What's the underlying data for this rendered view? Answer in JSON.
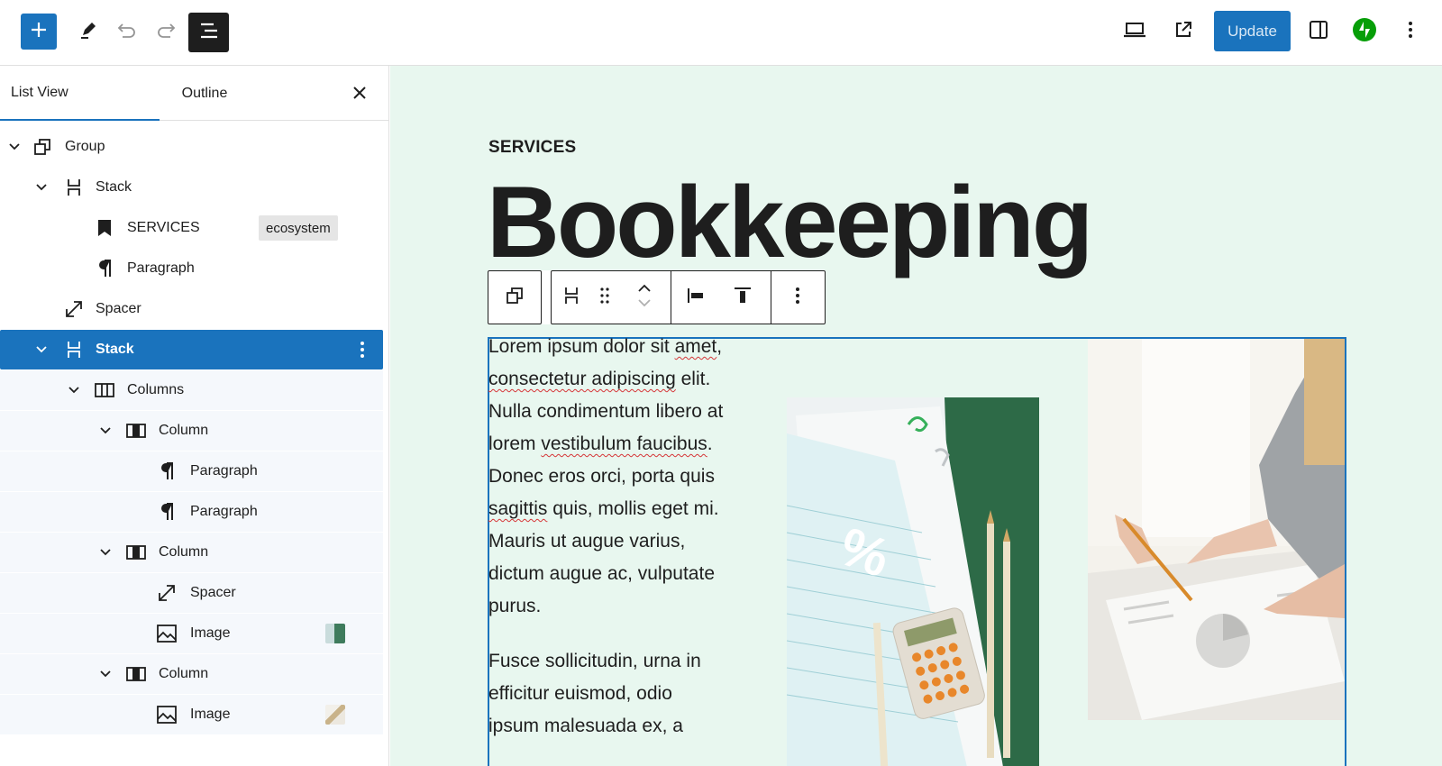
{
  "toolbar": {
    "add_label": "Toggle block inserter",
    "update_label": "Update",
    "colors": {
      "accent": "#1a73bd",
      "jetpack": "#069e08"
    },
    "icons": [
      "plus-icon",
      "pencil-icon",
      "undo-icon",
      "redo-icon",
      "list-view-icon",
      "laptop-icon",
      "external-link-icon",
      "sidebar-icon",
      "jetpack-icon",
      "more-vertical-icon"
    ]
  },
  "sidebar": {
    "tabs": [
      {
        "label": "List View",
        "active": true
      },
      {
        "label": "Outline",
        "active": false
      }
    ],
    "tree": [
      {
        "label": "Group",
        "icon": "group-icon",
        "level": 0,
        "expanded": true
      },
      {
        "label": "Stack",
        "icon": "stack-icon",
        "level": 1,
        "expanded": true
      },
      {
        "label": "SERVICES",
        "icon": "bookmark-icon",
        "level": 2,
        "badge": "ecosystem"
      },
      {
        "label": "Paragraph",
        "icon": "paragraph-icon",
        "level": 2
      },
      {
        "label": "Spacer",
        "icon": "spacer-icon",
        "level": 1
      },
      {
        "label": "Stack",
        "icon": "stack-icon",
        "level": 1,
        "expanded": true,
        "selected": true
      },
      {
        "label": "Columns",
        "icon": "columns-icon",
        "level": 2,
        "expanded": true
      },
      {
        "label": "Column",
        "icon": "column-icon",
        "level": 3,
        "expanded": true
      },
      {
        "label": "Paragraph",
        "icon": "paragraph-icon",
        "level": 4
      },
      {
        "label": "Paragraph",
        "icon": "paragraph-icon",
        "level": 4
      },
      {
        "label": "Column",
        "icon": "column-icon",
        "level": 3,
        "expanded": true
      },
      {
        "label": "Spacer",
        "icon": "spacer-icon",
        "level": 4
      },
      {
        "label": "Image",
        "icon": "image-icon",
        "level": 4,
        "thumb": "green-paperwork"
      },
      {
        "label": "Column",
        "icon": "column-icon",
        "level": 3,
        "expanded": true
      },
      {
        "label": "Image",
        "icon": "image-icon",
        "level": 4,
        "thumb": "hands-document"
      }
    ]
  },
  "canvas": {
    "eyebrow": "SERVICES",
    "heading": "Bookkeeping",
    "paragraph1": {
      "parts": [
        "Lorem ipsum dolor sit ",
        "amet",
        ",",
        "consectetur adipiscing",
        " elit.",
        "Nulla condimentum libero at",
        "lorem ",
        "vestibulum faucibus",
        ".",
        "Donec eros orci, porta quis",
        "sagittis",
        " quis, mollis eget mi.",
        "Mauris ut augue varius,",
        "dictum augue ac, vulputate",
        "purus."
      ]
    },
    "paragraph2": {
      "lines": [
        "Fusce sollicitudin, urna in",
        "efficitur euismod, odio",
        "ipsum malesuada ex, a"
      ]
    },
    "block_toolbar_icons": [
      "group-icon",
      "stack-icon",
      "drag-handle-icon",
      "move-up-icon",
      "move-down-icon",
      "justify-left-icon",
      "align-top-icon",
      "more-vertical-icon"
    ],
    "background": "#e8f7ef"
  }
}
